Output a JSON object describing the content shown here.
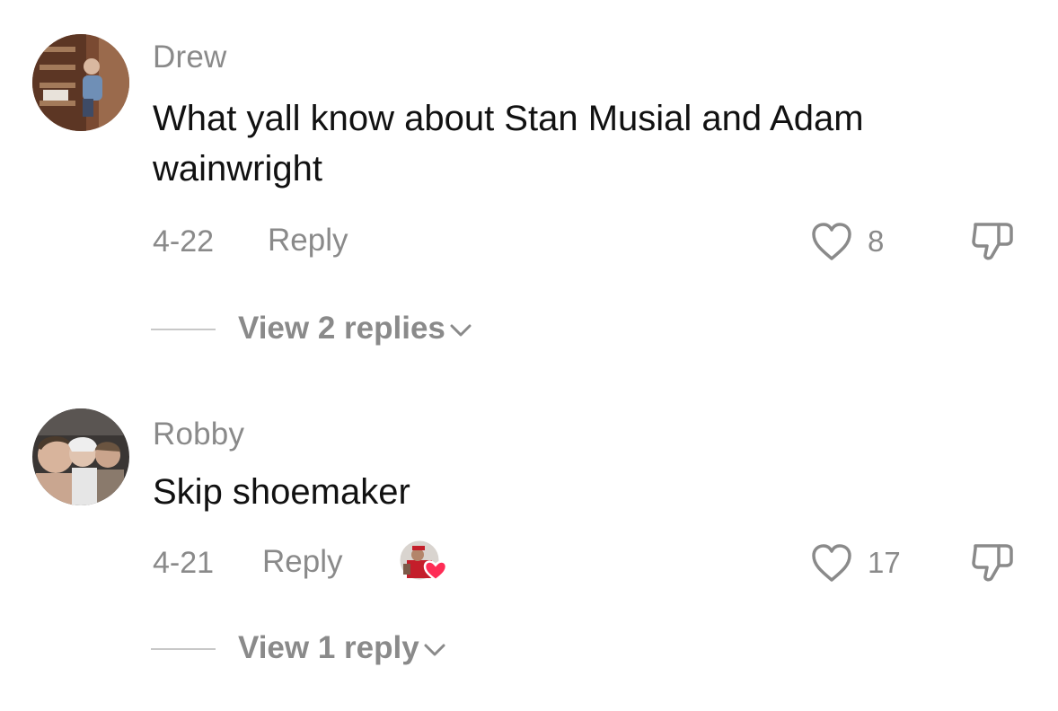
{
  "comments": [
    {
      "username": "Drew",
      "text": "What yall know about Stan Musial and Adam wainwright",
      "date": "4-22",
      "reply_label": "Reply",
      "like_count": "8",
      "view_replies_label": "View 2 replies",
      "creator_liked": false
    },
    {
      "username": "Robby",
      "text": "Skip shoemaker",
      "date": "4-21",
      "reply_label": "Reply",
      "like_count": "17",
      "view_replies_label": "View 1 reply",
      "creator_liked": true
    }
  ],
  "icons": {
    "like": "heart-outline-icon",
    "dislike": "thumbs-down-icon",
    "expand": "chevron-down-icon",
    "creator_badge_heart": "heart-filled-icon"
  },
  "colors": {
    "secondary_text": "#8a8a8a",
    "primary_text": "#111111",
    "creator_heart": "#fe2c55",
    "divider": "#c8c8c8"
  }
}
